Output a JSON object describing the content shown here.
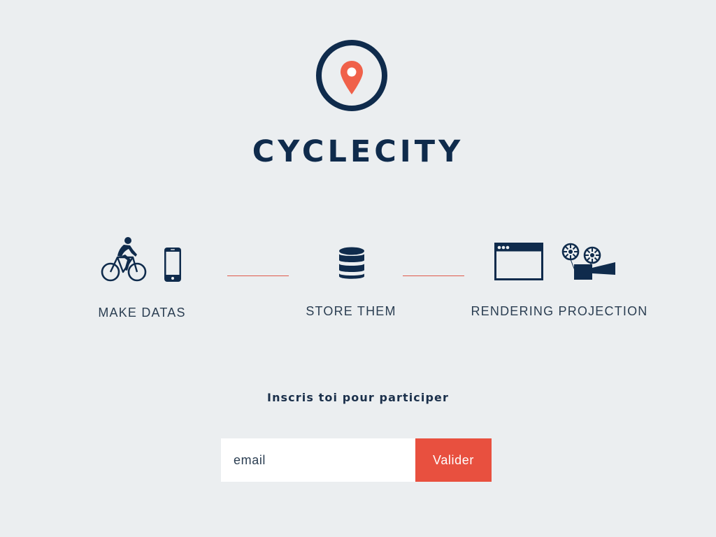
{
  "brand": {
    "name": "CYCLECITY",
    "logo_icon": "map-pin-circle-icon"
  },
  "steps": [
    {
      "label": "MAKE DATAS",
      "icons": [
        "bicycle-rider-icon",
        "smartphone-icon"
      ]
    },
    {
      "label": "STORE THEM",
      "icons": [
        "database-icon"
      ]
    },
    {
      "label": "RENDERING PROJECTION",
      "icons": [
        "browser-window-icon",
        "film-projector-icon"
      ]
    }
  ],
  "signup": {
    "prompt": "Inscris toi pour participer",
    "email_placeholder": "email",
    "submit_label": "Valider"
  },
  "colors": {
    "background": "#ebeef0",
    "navy": "#0f2b4c",
    "accent": "#e8503f",
    "pin": "#f0614a"
  }
}
